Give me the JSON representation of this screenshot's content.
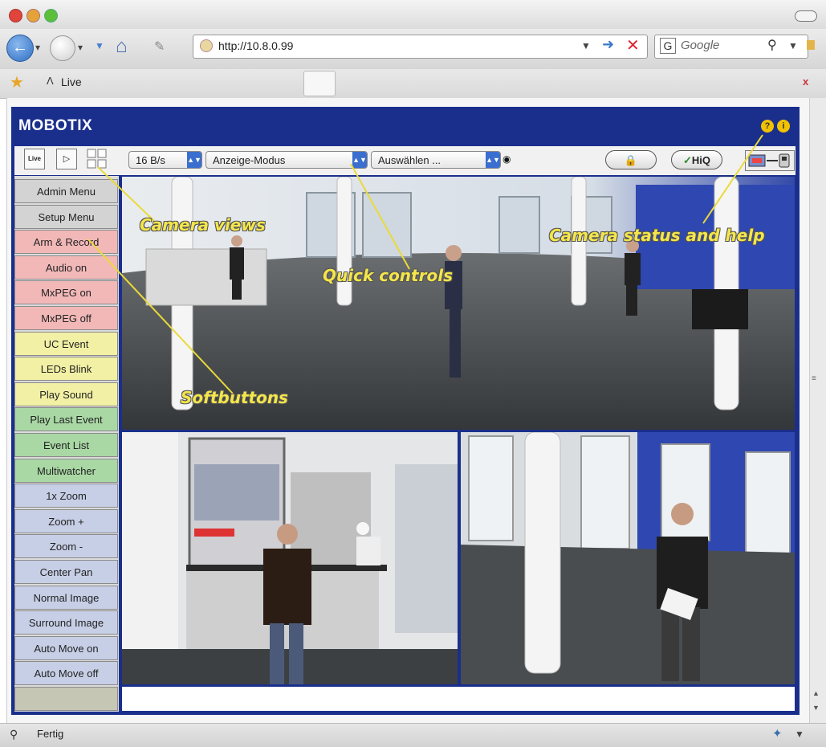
{
  "browser": {
    "url": "http://10.8.0.99",
    "search_placeholder": "Google",
    "tab_label": "Live",
    "status_text": "Fertig",
    "close_tab": "x"
  },
  "app": {
    "brand": "MOBOTIX",
    "toolbar": {
      "frame_rate": "16 B/s",
      "display_mode": "Anzeige-Modus",
      "select": "Auswählen ...",
      "hiq_label": "HiQ"
    },
    "softbuttons": [
      {
        "label": "Admin Menu",
        "color": "#d3d3d3"
      },
      {
        "label": "Setup Menu",
        "color": "#d3d3d3"
      },
      {
        "label": "Arm & Record",
        "color": "#f2b8b8"
      },
      {
        "label": "Audio on",
        "color": "#f2b8b8"
      },
      {
        "label": "MxPEG on",
        "color": "#f2b8b8"
      },
      {
        "label": "MxPEG off",
        "color": "#f2b8b8"
      },
      {
        "label": "UC Event",
        "color": "#f2f0a4"
      },
      {
        "label": "LEDs Blink",
        "color": "#f2f0a4"
      },
      {
        "label": "Play Sound",
        "color": "#f2f0a4"
      },
      {
        "label": "Play Last Event",
        "color": "#a9d8a4"
      },
      {
        "label": "Event List",
        "color": "#a9d8a4"
      },
      {
        "label": "Multiwatcher",
        "color": "#a9d8a4"
      },
      {
        "label": "1x Zoom",
        "color": "#c7cfe6"
      },
      {
        "label": "Zoom +",
        "color": "#c7cfe6"
      },
      {
        "label": "Zoom -",
        "color": "#c7cfe6"
      },
      {
        "label": "Center Pan",
        "color": "#c7cfe6"
      },
      {
        "label": "Normal Image",
        "color": "#c7cfe6"
      },
      {
        "label": "Surround Image",
        "color": "#c7cfe6"
      },
      {
        "label": "Auto Move on",
        "color": "#c7cfe6"
      },
      {
        "label": "Auto Move off",
        "color": "#c7cfe6"
      }
    ],
    "bottom_button_color": "#c6c6b4"
  },
  "annotations": {
    "camera_views": "Camera views",
    "quick_controls": "Quick controls",
    "camera_status": "Camera status and help",
    "softbuttons": "Softbuttons"
  },
  "icons": [
    "back-arrow-icon",
    "home-icon",
    "refresh-icon",
    "stop-icon",
    "search-icon",
    "star-icon",
    "lock-icon",
    "help-icon",
    "info-icon",
    "pc-icon",
    "play-icon",
    "grid-icon"
  ]
}
